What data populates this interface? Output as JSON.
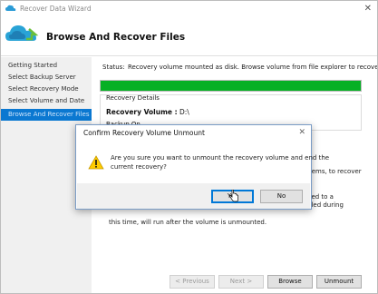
{
  "window": {
    "title": "Recover Data Wizard",
    "close_glyph": "✕"
  },
  "header": {
    "heading": "Browse And Recover Files"
  },
  "sidebar": {
    "items": [
      {
        "label": "Getting Started"
      },
      {
        "label": "Select Backup Server"
      },
      {
        "label": "Select Recovery Mode"
      },
      {
        "label": "Select Volume and Date"
      },
      {
        "label": "Browse And Recover Files"
      }
    ],
    "active_index": 4
  },
  "status": {
    "label": "Status:",
    "text": "Recovery volume mounted as disk. Browse volume from file explorer to recover items.",
    "progress_percent": 100,
    "progress_color": "#06b025"
  },
  "details": {
    "group_title": "Recovery Details",
    "volume_label": "Recovery Volume :",
    "volume_value": "D:\\",
    "partial_row": "Backup On . . ."
  },
  "background_text": {
    "fragment_a": "items, to recover",
    "fragment_b": "ded to a",
    "fragment_c": "this time, will run after the volume is unmounted.",
    "fragment_c_right": "uled during"
  },
  "footer": {
    "previous": "< Previous",
    "next": "Next >",
    "browse": "Browse",
    "unmount": "Unmount"
  },
  "dialog": {
    "title": "Confirm Recovery Volume Unmount",
    "close_glyph": "✕",
    "message_line1": "Are you sure you want to unmount the recovery volume and end the",
    "message_line2": "current recovery?",
    "yes": "Yes",
    "no": "No",
    "icon": "warning-icon",
    "accent_color": "#0078d7"
  }
}
